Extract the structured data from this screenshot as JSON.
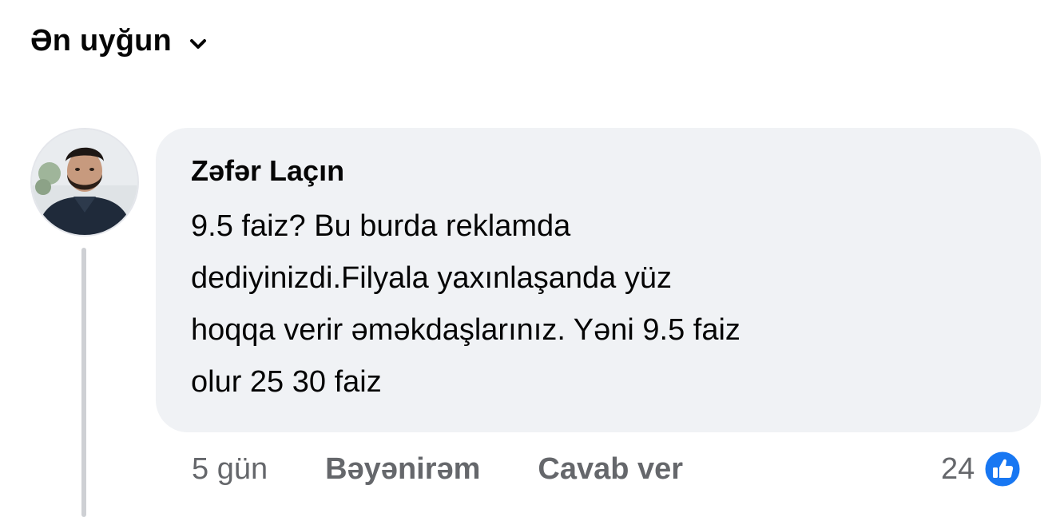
{
  "sort": {
    "label": "Ən uyğun",
    "icon": "chevron-down-icon"
  },
  "comment": {
    "author": "Zəfər Laçın",
    "lines": [
      "9.5 faiz? Bu burda reklamda",
      "dediyinizdi.Filyala yaxınlaşanda yüz",
      "hoqqa verir əməkdaşlarınız. Yəni 9.5 faiz",
      "olur 25 30 faiz"
    ],
    "time": "5 gün",
    "like_label": "Bəyənirəm",
    "reply_label": "Cavab ver",
    "reaction_count": "24",
    "reaction_icon": "thumbs-up-icon"
  },
  "colors": {
    "bubble_bg": "#f0f2f5",
    "secondary_text": "#65676b",
    "like_blue": "#1877f2",
    "thread_line": "#ced0d4"
  }
}
